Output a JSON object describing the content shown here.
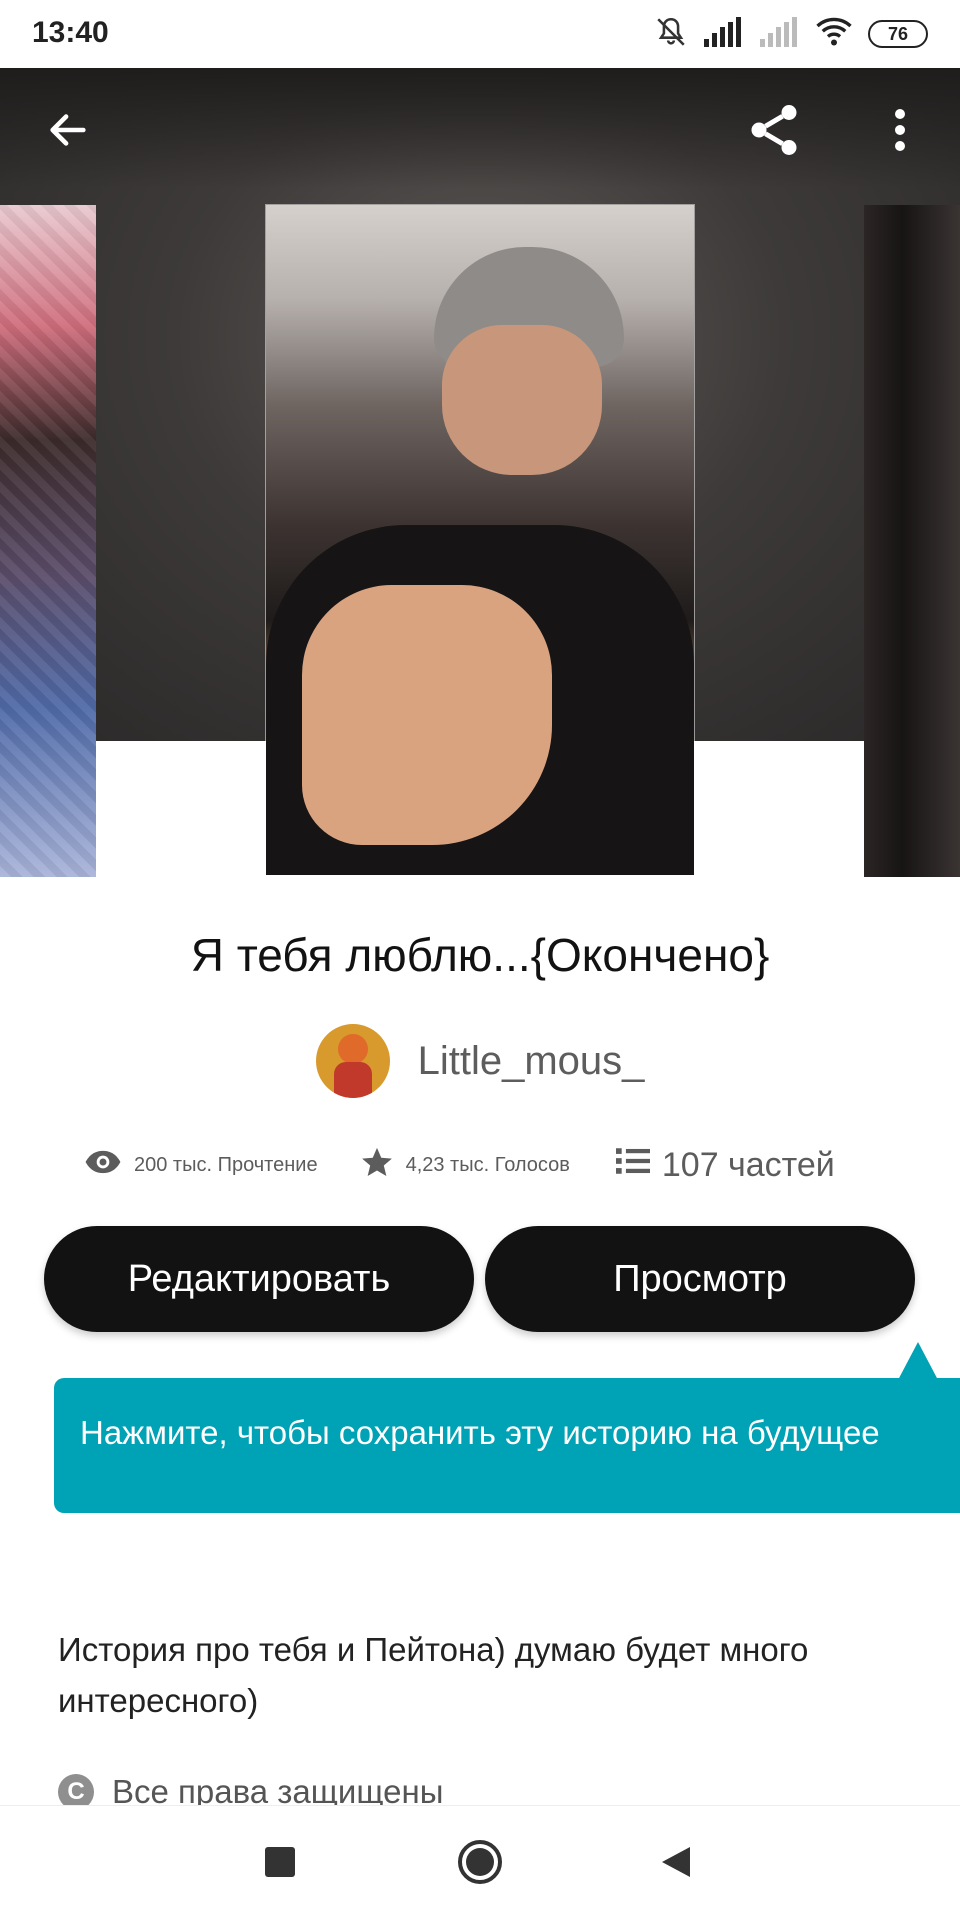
{
  "status_bar": {
    "time": "13:40",
    "battery": "76",
    "icons": [
      "bell-muted-icon",
      "signal-icon",
      "signal-empty-icon",
      "wifi-icon",
      "battery-icon"
    ]
  },
  "header": {
    "back_icon": "arrow-left-icon",
    "share_icon": "share-icon",
    "more_icon": "more-vertical-icon"
  },
  "story": {
    "title": "Я тебя люблю...{Окончено}",
    "author": "Little_mous_",
    "stats": {
      "reads": "200 тыс. Прочтение",
      "votes": "4,23 тыс. Голосов",
      "parts": "107 частей"
    },
    "description": "История про тебя и Пейтона) думаю будет много интересного)",
    "copyright": "Все права защищены"
  },
  "buttons": {
    "edit": "Редактировать",
    "view": "Просмотр"
  },
  "tooltip": {
    "text": "Нажмите, чтобы сохранить эту историю на будущее",
    "color": "#00a3b5"
  },
  "nav_bar": {
    "icons": [
      "recents-icon",
      "home-icon",
      "back-triangle-icon"
    ]
  }
}
